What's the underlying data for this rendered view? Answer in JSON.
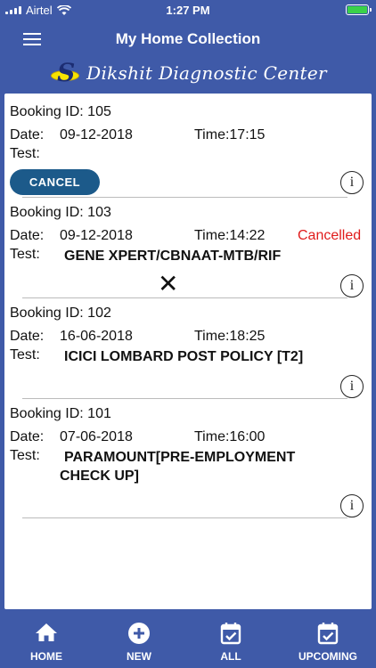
{
  "status": {
    "carrier": "Airtel",
    "time": "1:27 PM"
  },
  "header": {
    "title": "My Home Collection"
  },
  "banner": {
    "brand": "Dikshit Diagnostic Center"
  },
  "bookings": [
    {
      "id_label": "Booking ID:",
      "id": "105",
      "date_label": "Date:",
      "date": "09-12-2018",
      "time": "Time:17:15",
      "test_label": "Test:",
      "test": "",
      "status": "",
      "action": "CANCEL"
    },
    {
      "id_label": "Booking ID:",
      "id": "103",
      "date_label": "Date:",
      "date": "09-12-2018",
      "time": "Time:14:22",
      "test_label": "Test:",
      "test": "GENE XPERT/CBNAAT-MTB/RIF",
      "status": "Cancelled",
      "action": "✕"
    },
    {
      "id_label": "Booking ID:",
      "id": "102",
      "date_label": "Date:",
      "date": "16-06-2018",
      "time": "Time:18:25",
      "test_label": "Test:",
      "test": "ICICI LOMBARD POST POLICY [T2]",
      "status": "",
      "action": ""
    },
    {
      "id_label": "Booking ID:",
      "id": "101",
      "date_label": "Date:",
      "date": "07-06-2018",
      "time": "Time:16:00",
      "test_label": "Test:",
      "test_line1": "PARAMOUNT[PRE-EMPLOYMENT",
      "test_line2": "CHECK UP]",
      "status": "",
      "action": ""
    }
  ],
  "info_glyph": "i",
  "tabs": [
    {
      "label": "HOME",
      "icon": "home-icon"
    },
    {
      "label": "NEW",
      "icon": "plus-circle-icon"
    },
    {
      "label": "ALL",
      "icon": "calendar-check-icon"
    },
    {
      "label": "UPCOMING",
      "icon": "calendar-check-icon"
    }
  ],
  "colors": {
    "primary": "#3f5aa8",
    "cancel_button": "#1c5a8a",
    "cancelled_text": "#e01b1b",
    "logo_yellow": "#f7e300"
  }
}
